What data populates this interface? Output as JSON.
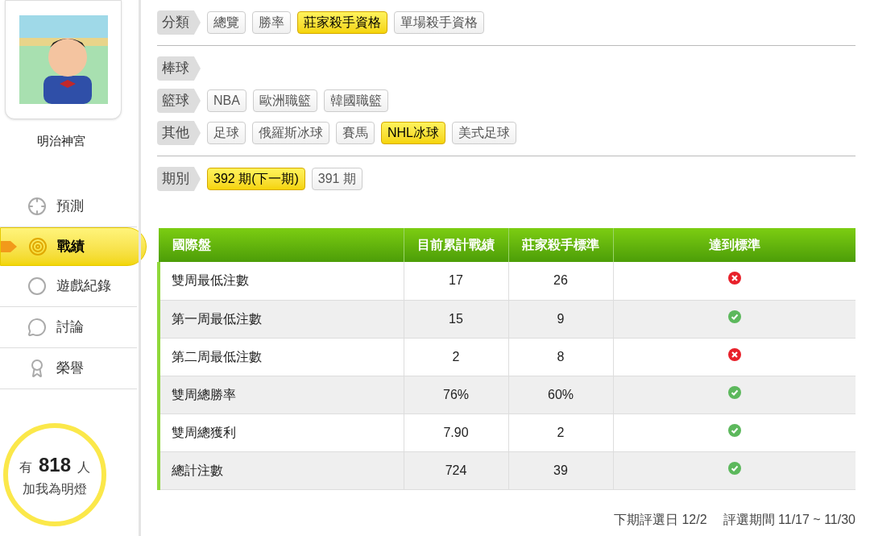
{
  "profile": {
    "name": "明治神宮"
  },
  "nav": [
    {
      "label": "預測",
      "kind": "crosshair",
      "selected": false
    },
    {
      "label": "戰績",
      "kind": "target",
      "selected": true
    },
    {
      "label": "遊戲紀錄",
      "kind": "ring",
      "selected": false
    },
    {
      "label": "討論",
      "kind": "chat",
      "selected": false
    },
    {
      "label": "榮譽",
      "kind": "medal",
      "selected": false
    }
  ],
  "fans": {
    "prefix": "有",
    "count": "818",
    "suffix": "人",
    "caption": "加我為明燈"
  },
  "filter_groups": [
    {
      "rows": [
        {
          "label": "分類",
          "options": [
            {
              "label": "總覽",
              "selected": false
            },
            {
              "label": "勝率",
              "selected": false
            },
            {
              "label": "莊家殺手資格",
              "selected": true
            },
            {
              "label": "單場殺手資格",
              "selected": false
            }
          ]
        }
      ]
    },
    {
      "rows": [
        {
          "label": "棒球",
          "options": []
        },
        {
          "label": "籃球",
          "options": [
            {
              "label": "NBA",
              "selected": false
            },
            {
              "label": "歐洲職籃",
              "selected": false
            },
            {
              "label": "韓國職籃",
              "selected": false
            }
          ]
        },
        {
          "label": "其他",
          "options": [
            {
              "label": "足球",
              "selected": false
            },
            {
              "label": "俄羅斯冰球",
              "selected": false
            },
            {
              "label": "賽馬",
              "selected": false
            },
            {
              "label": "NHL冰球",
              "selected": true
            },
            {
              "label": "美式足球",
              "selected": false
            }
          ]
        }
      ]
    },
    {
      "rows": [
        {
          "label": "期別",
          "options": [
            {
              "label": "392 期(下一期)",
              "selected": true
            },
            {
              "label": "391 期",
              "selected": false
            }
          ]
        }
      ]
    }
  ],
  "table": {
    "columns": [
      "國際盤",
      "目前累計戰績",
      "莊家殺手標準",
      "達到標準"
    ],
    "rows": [
      {
        "label": "雙周最低注數",
        "current": "17",
        "standard": "26",
        "met": false
      },
      {
        "label": "第一周最低注數",
        "current": "15",
        "standard": "9",
        "met": true
      },
      {
        "label": "第二周最低注數",
        "current": "2",
        "standard": "8",
        "met": false
      },
      {
        "label": "雙周總勝率",
        "current": "76%",
        "standard": "60%",
        "met": true
      },
      {
        "label": "雙周總獲利",
        "current": "7.90",
        "standard": "2",
        "met": true
      },
      {
        "label": "總計注數",
        "current": "724",
        "standard": "39",
        "met": true
      }
    ]
  },
  "footer": {
    "next_date": "下期評選日 12/2",
    "period": "評選期間 11/17 ~ 11/30"
  }
}
